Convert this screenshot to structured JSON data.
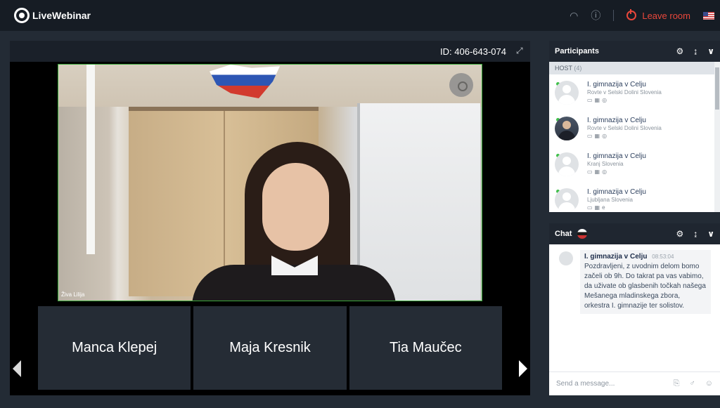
{
  "app": {
    "title": "LiveWebinar"
  },
  "topbar": {
    "leave_label": "Leave room"
  },
  "stage": {
    "room_id": "ID: 406-643-074",
    "main_video_name": "Živa Lilija",
    "tiles": [
      "Manca Klepej",
      "Maja Kresnik",
      "Tia Maučec"
    ]
  },
  "participants": {
    "title": "Participants",
    "host_label": "HOST",
    "host_count": "(4)",
    "items": [
      {
        "name": "I. gimnazija v Celju",
        "location": "Rovte v Selski Dolini Slovenia"
      },
      {
        "name": "I. gimnazija v Celju",
        "location": "Rovte v Selski Dolini Slovenia"
      },
      {
        "name": "I. gimnazija v Celju",
        "location": "Kranj Slovenia"
      },
      {
        "name": "I. gimnazija v Celju",
        "location": "Ljubljana Slovenia"
      }
    ]
  },
  "chat": {
    "title": "Chat",
    "messages": [
      {
        "author": "I. gimnazija v Celju",
        "time": "08:53:04",
        "text": "Pozdravljeni, z uvodnim delom bomo začeli ob 9h. Do takrat pa vas vabimo, da uživate ob glasbenih točkah našega Mešanega mladinskega zbora, orkestra I. gimnazije ter solistov."
      }
    ],
    "input_placeholder": "Send a message..."
  }
}
